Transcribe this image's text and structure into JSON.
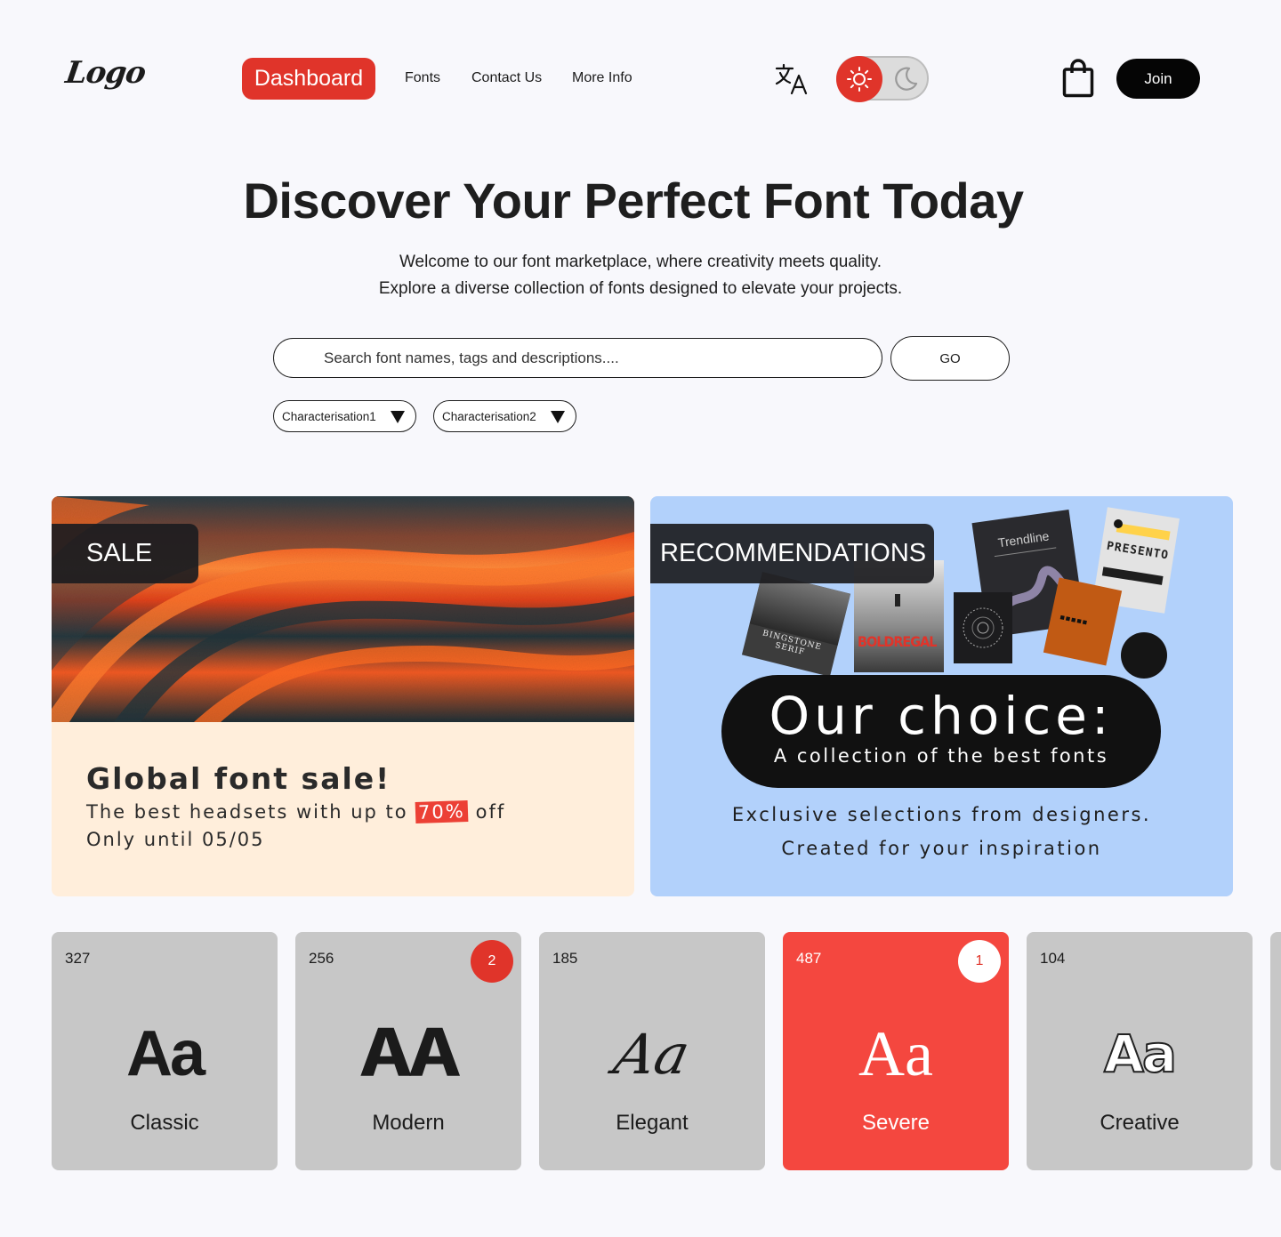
{
  "header": {
    "logo": "Logo",
    "nav": [
      {
        "label": "Dashboard",
        "active": true
      },
      {
        "label": "Fonts",
        "active": false
      },
      {
        "label": "Contact Us",
        "active": false
      },
      {
        "label": "More Info",
        "active": false
      }
    ],
    "translate_icon": "translate-icon",
    "theme": {
      "mode": "light",
      "light_icon": "sun-icon",
      "dark_icon": "moon-icon"
    },
    "cart_icon": "shopping-bag-icon",
    "join_label": "Join"
  },
  "hero": {
    "title": "Discover Your Perfect Font Today",
    "subtitle_line1": "Welcome to our font marketplace, where creativity meets quality.",
    "subtitle_line2": "Explore a diverse collection of fonts designed to elevate your projects."
  },
  "search": {
    "placeholder": "Search font names, tags and descriptions....",
    "value": "",
    "go_label": "GO",
    "filters": [
      {
        "label": "Characterisation1"
      },
      {
        "label": "Characterisation2"
      }
    ]
  },
  "sale": {
    "badge": "SALE",
    "title": "Global font sale!",
    "text_before": "The best headsets with up to",
    "highlight": "70%",
    "text_after": "off",
    "until": "Only until 05/05"
  },
  "recommendations": {
    "badge": "RECOMMENDATIONS",
    "posters": [
      "Trendline",
      "PRESENTO",
      "BOLDREGAL",
      "BINGSTONE SERIF"
    ],
    "choice_title": "Our choice:",
    "choice_sub": "A collection of the best fonts",
    "line1": "Exclusive selections from designers.",
    "line2": "Created for your inspiration"
  },
  "categories": [
    {
      "count": "327",
      "sample": "Aa",
      "label": "Classic",
      "badge": "",
      "active": false
    },
    {
      "count": "256",
      "sample": "AA",
      "label": "Modern",
      "badge": "2",
      "active": false
    },
    {
      "count": "185",
      "sample": "Aa",
      "label": "Elegant",
      "badge": "",
      "active": false
    },
    {
      "count": "487",
      "sample": "Aa",
      "label": "Severe",
      "badge": "1",
      "active": true
    },
    {
      "count": "104",
      "sample": "Aa",
      "label": "Creative",
      "badge": "",
      "active": false
    }
  ],
  "colors": {
    "accent": "#e0342a",
    "active_card": "#f4473f",
    "sale_bg": "#ffeedb",
    "rec_bg": "#b2d1fb",
    "card_bg": "#c7c7c7"
  }
}
